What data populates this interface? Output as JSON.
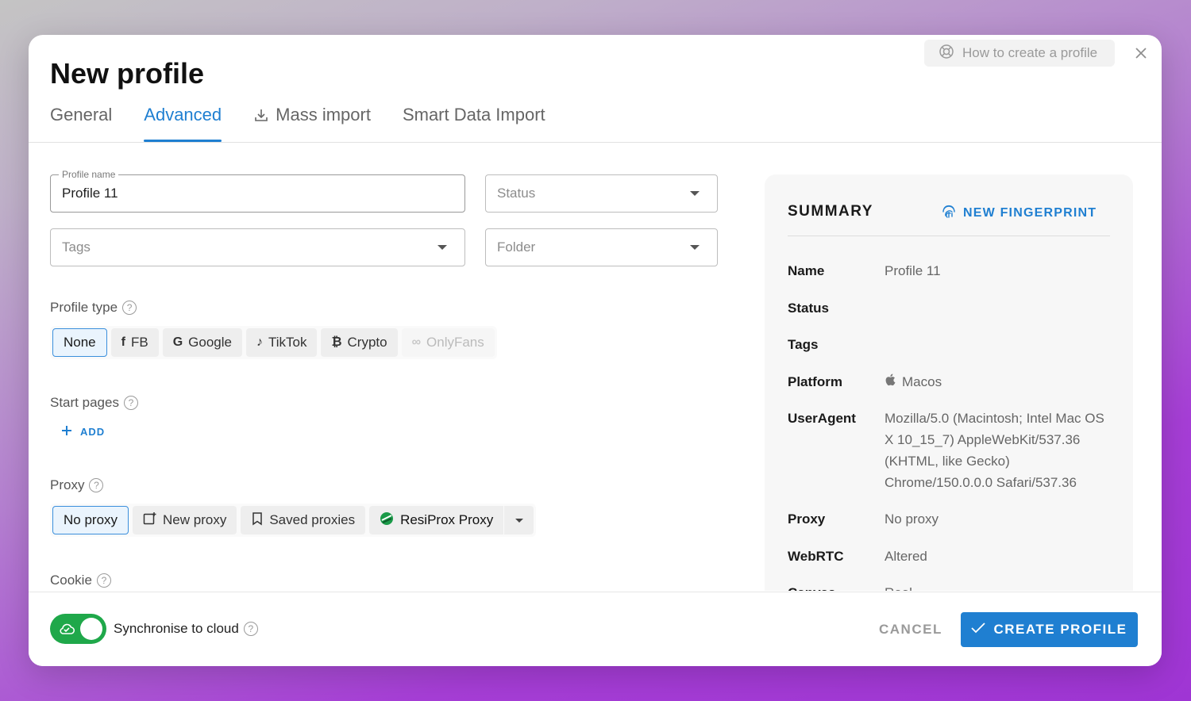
{
  "modal": {
    "title": "New profile",
    "help_button": "How to create a profile"
  },
  "tabs": [
    {
      "label": "General",
      "active": false
    },
    {
      "label": "Advanced",
      "active": true
    },
    {
      "label": "Mass import",
      "active": false
    },
    {
      "label": "Smart Data Import",
      "active": false
    }
  ],
  "form": {
    "profile_name": {
      "legend": "Profile name",
      "value": "Profile 11"
    },
    "status": {
      "placeholder": "Status"
    },
    "tags": {
      "placeholder": "Tags"
    },
    "folder": {
      "placeholder": "Folder"
    },
    "profile_type": {
      "label": "Profile type",
      "options": [
        "None",
        "FB",
        "Google",
        "TikTok",
        "Crypto",
        "OnlyFans"
      ],
      "selected": "None"
    },
    "start_pages": {
      "label": "Start pages",
      "add_label": "ADD"
    },
    "proxy": {
      "label": "Proxy",
      "options": [
        "No proxy",
        "New proxy",
        "Saved proxies",
        "ResiProx Proxy"
      ],
      "selected": "No proxy"
    },
    "cookie": {
      "label": "Cookie"
    }
  },
  "summary": {
    "title": "SUMMARY",
    "new_fingerprint": "NEW FINGERPRINT",
    "rows": [
      {
        "key": "Name",
        "value": "Profile 11"
      },
      {
        "key": "Status",
        "value": ""
      },
      {
        "key": "Tags",
        "value": ""
      },
      {
        "key": "Platform",
        "value": "Macos"
      },
      {
        "key": "UserAgent",
        "value": "Mozilla/5.0 (Macintosh; Intel Mac OS X 10_15_7) AppleWebKit/537.36 (KHTML, like Gecko) Chrome/150.0.0.0 Safari/537.36"
      },
      {
        "key": "Proxy",
        "value": "No proxy"
      },
      {
        "key": "WebRTC",
        "value": "Altered"
      },
      {
        "key": "Canvas",
        "value": "Real"
      }
    ]
  },
  "footer": {
    "sync_label": "Synchronise to cloud",
    "sync_enabled": true,
    "cancel": "CANCEL",
    "create": "CREATE PROFILE"
  },
  "colors": {
    "accent": "#1f7fd1",
    "toggle_on": "#1fa84a"
  }
}
